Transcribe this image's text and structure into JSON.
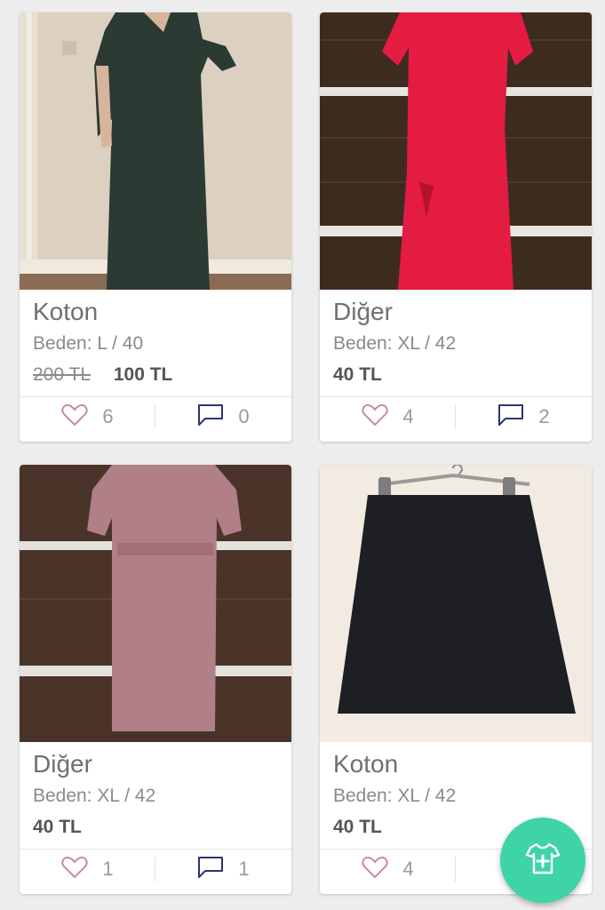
{
  "listings": [
    {
      "brand": "Koton",
      "size": "Beden: L / 40",
      "old_price": "200 TL",
      "price": "100 TL",
      "likes": "6",
      "comments": "0",
      "photo": "dark-green maxi dress"
    },
    {
      "brand": "Diğer",
      "size": "Beden: XL / 42",
      "price": "40 TL",
      "likes": "4",
      "comments": "2",
      "photo": "red dress"
    },
    {
      "brand": "Diğer",
      "size": "Beden: XL / 42",
      "price": "40 TL",
      "likes": "1",
      "comments": "1",
      "photo": "pink midi dress"
    },
    {
      "brand": "Koton",
      "size": "Beden: XL / 42",
      "price": "40 TL",
      "likes": "4",
      "comments": "",
      "photo": "black skirt on hanger"
    }
  ],
  "colors": {
    "accent": "#3fd4a8",
    "heart": "#c88aa6",
    "comment": "#2c3470"
  },
  "fab": {
    "icon": "tshirt-plus-icon"
  }
}
